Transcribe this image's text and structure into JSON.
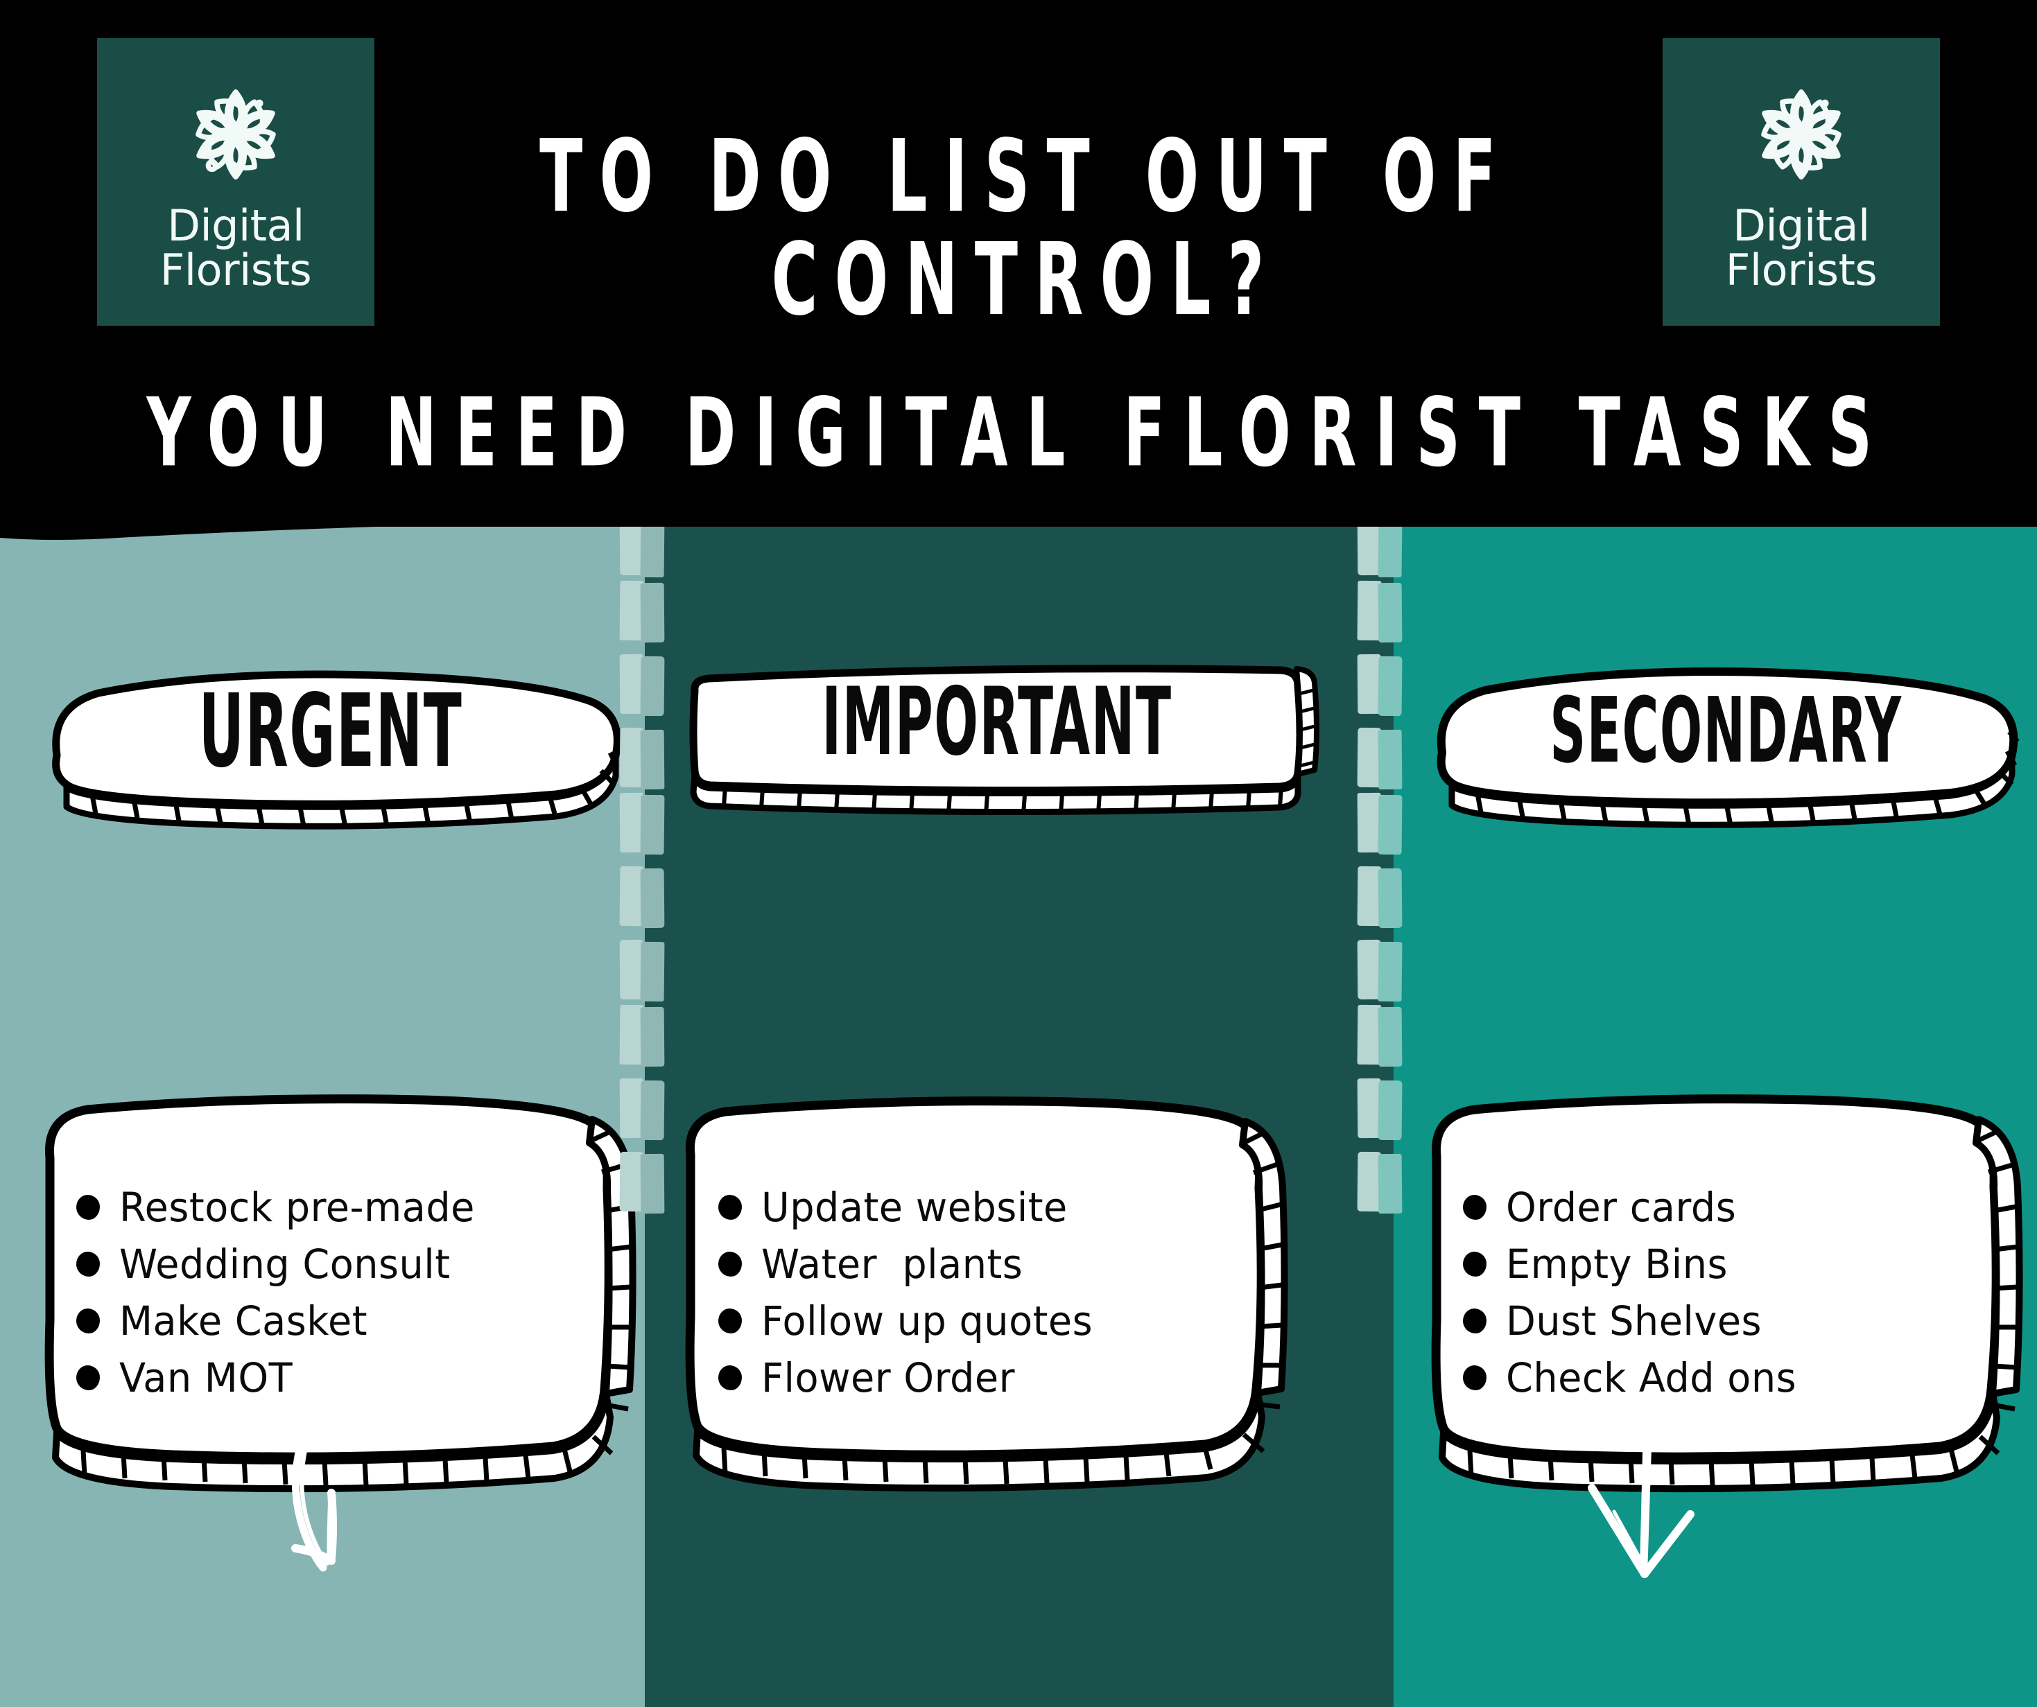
{
  "brand": {
    "logo_icon": "flower-mandala-icon",
    "name_line1": "Digital",
    "name_line2": "Florists",
    "box_color": "#1b4d47"
  },
  "header": {
    "title_line1": "TO DO LIST OUT OF",
    "title_line2": "CONTROL?",
    "subtitle": "YOU NEED DIGITAL FLORIST TASKS",
    "background_color": "#000000",
    "text_color": "#ffffff"
  },
  "columns": [
    {
      "id": "urgent",
      "badge_label": "URGENT",
      "badge_shape": "rounded-pill",
      "arrow_icon": "curved-arrow-down-right-icon",
      "background_color": "#87b5b4",
      "tasks": [
        "Restock pre-made",
        "Wedding Consult",
        "Make Casket",
        "Van MOT"
      ]
    },
    {
      "id": "important",
      "badge_label": "IMPORTANT",
      "badge_shape": "slab-rectangle",
      "arrow_icon": "straight-arrow-down-icon",
      "background_color": "#1b514c",
      "tasks": [
        "Update website",
        "Water  plants",
        "Follow up quotes",
        "Flower Order"
      ]
    },
    {
      "id": "secondary",
      "badge_label": "SECONDARY",
      "badge_shape": "rounded-pill",
      "arrow_icon": "curved-arrow-down-left-icon",
      "background_color": "#0f9488",
      "tasks": [
        "Order cards",
        "Empty Bins",
        "Dust Shelves",
        "Check Add ons"
      ]
    }
  ],
  "divider": {
    "style": "hand-painted-dashed",
    "dash_color_light": "#b9d5d2",
    "dash_color_mid": "#8fb8b5",
    "dash_color_pale": "#7fc4bd"
  },
  "card": {
    "fill_color": "#ffffff",
    "outline_color": "#000000",
    "bullet_color": "#000000"
  }
}
